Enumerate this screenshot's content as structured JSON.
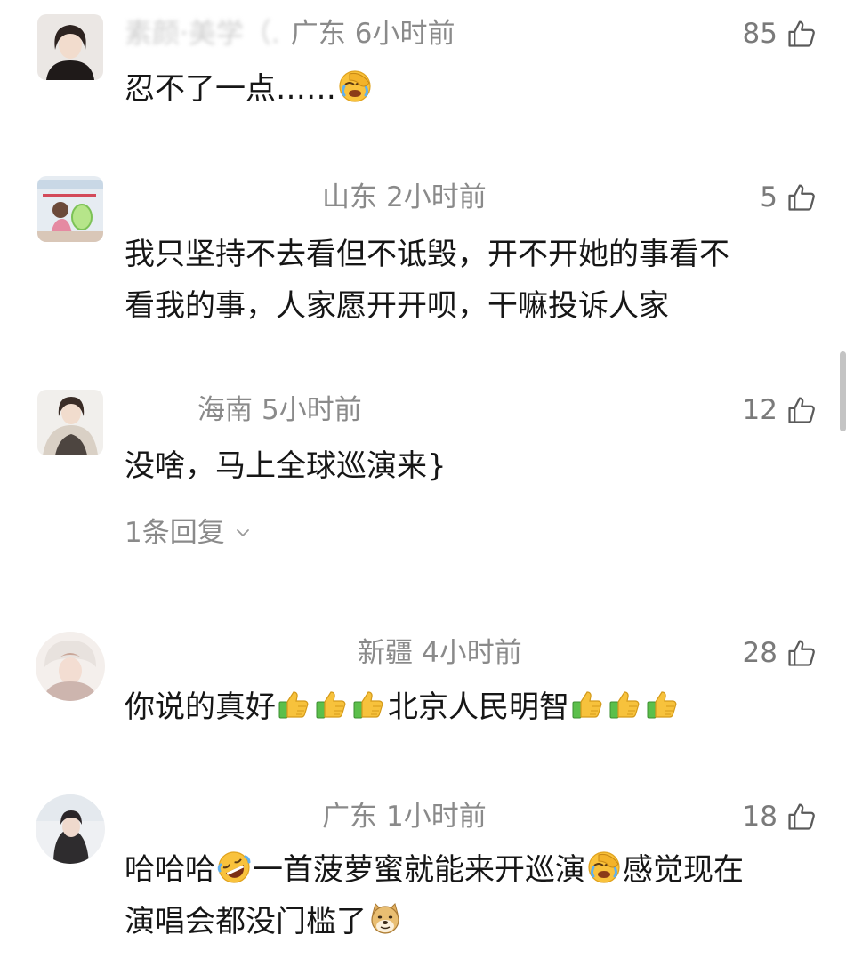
{
  "comments": [
    {
      "name": "素颜·美学（.",
      "location": "广东",
      "time": "6小时前",
      "likes": "85",
      "text_lines": [
        "忍不了一点……"
      ]
    },
    {
      "name": "",
      "location": "山东",
      "time": "2小时前",
      "likes": "5",
      "text_lines": [
        "我只坚持不去看但不诋毁，开不开她的事看不",
        "看我的事，人家愿开开呗，干嘛投诉人家"
      ]
    },
    {
      "name": "",
      "location": "海南",
      "time": "5小时前",
      "likes": "12",
      "text_lines": [
        "没啥，马上全球巡演来}"
      ],
      "reply_link": "1条回复"
    },
    {
      "name": "",
      "location": "新疆",
      "time": "4小时前",
      "likes": "28",
      "text_parts": [
        "你说的真好",
        "北京人民明智"
      ]
    },
    {
      "name": "",
      "location": "广东",
      "time": "1小时前",
      "likes": "18",
      "text_parts": [
        "哈哈哈",
        "一首菠萝蜜就能来开巡演",
        "感觉现在",
        "演唱会都没门槛了"
      ]
    }
  ],
  "icons": {
    "like": "thumbs-up-outline-icon",
    "expand": "chevron-down-icon",
    "emoji_facepalm": "facepalm-emoji",
    "emoji_thumbs_up": "thumbs-up-emoji",
    "emoji_rofl": "rofl-emoji",
    "emoji_doge": "doge-emoji"
  },
  "colors": {
    "text": "#161616",
    "meta": "#8a8a8a",
    "name_faded": "#cfcfcf"
  }
}
